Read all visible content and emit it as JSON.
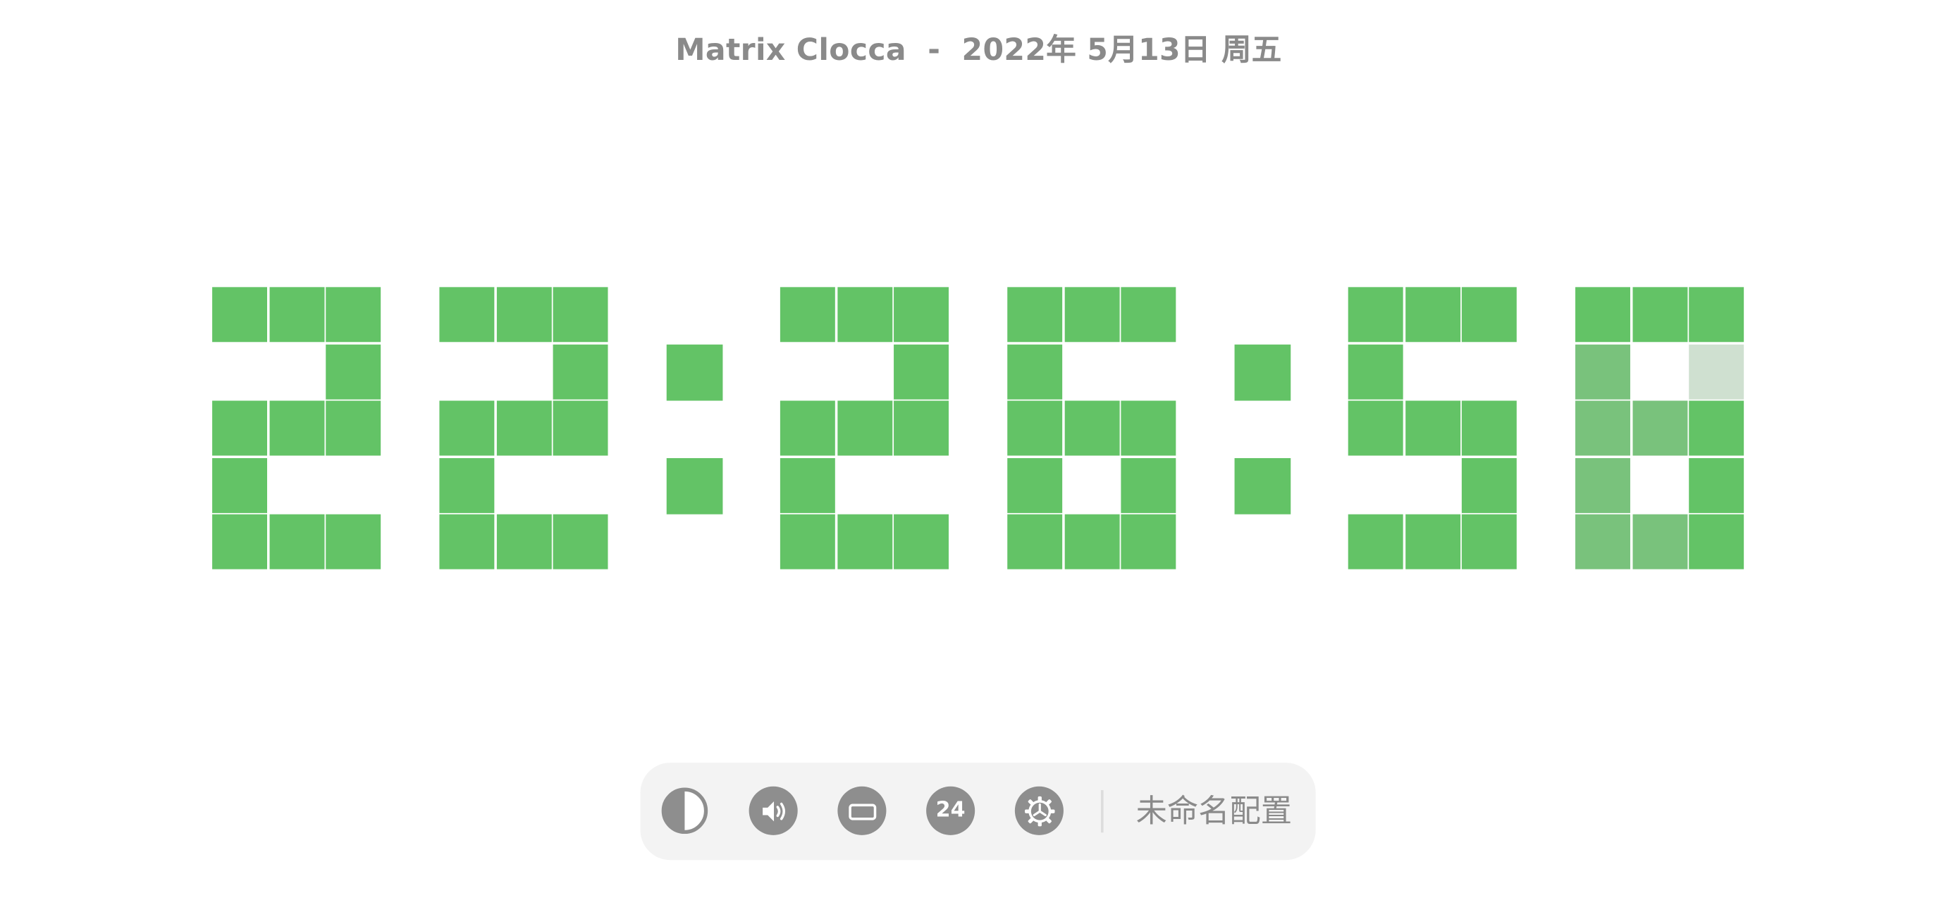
{
  "title": "Matrix Clocca  -  2022年 5月13日 周五",
  "clock": {
    "time": "22:26:58",
    "digits": [
      {
        "value": "2",
        "cells": [
          [
            "on",
            "on",
            "on"
          ],
          [
            "off",
            "off",
            "on"
          ],
          [
            "on",
            "on",
            "on"
          ],
          [
            "on",
            "off",
            "off"
          ],
          [
            "on",
            "on",
            "on"
          ]
        ]
      },
      {
        "value": "2",
        "cells": [
          [
            "on",
            "on",
            "on"
          ],
          [
            "off",
            "off",
            "on"
          ],
          [
            "on",
            "on",
            "on"
          ],
          [
            "on",
            "off",
            "off"
          ],
          [
            "on",
            "on",
            "on"
          ]
        ]
      },
      {
        "value": "2",
        "cells": [
          [
            "on",
            "on",
            "on"
          ],
          [
            "off",
            "off",
            "on"
          ],
          [
            "on",
            "on",
            "on"
          ],
          [
            "on",
            "off",
            "off"
          ],
          [
            "on",
            "on",
            "on"
          ]
        ]
      },
      {
        "value": "6",
        "cells": [
          [
            "on",
            "on",
            "on"
          ],
          [
            "on",
            "off",
            "off"
          ],
          [
            "on",
            "on",
            "on"
          ],
          [
            "on",
            "off",
            "on"
          ],
          [
            "on",
            "on",
            "on"
          ]
        ]
      },
      {
        "value": "5",
        "cells": [
          [
            "on",
            "on",
            "on"
          ],
          [
            "on",
            "off",
            "off"
          ],
          [
            "on",
            "on",
            "on"
          ],
          [
            "off",
            "off",
            "on"
          ],
          [
            "on",
            "on",
            "on"
          ]
        ]
      },
      {
        "value": "8",
        "cells": [
          [
            "on",
            "on",
            "on"
          ],
          [
            "fade",
            "off",
            "fade-light"
          ],
          [
            "fade",
            "fade",
            "on"
          ],
          [
            "fade",
            "off",
            "on"
          ],
          [
            "fade",
            "fade",
            "on"
          ]
        ]
      }
    ],
    "colors": {
      "on": "#63c366",
      "fade": "#79c27c",
      "fade-light": "#cfe0d0",
      "off": "transparent"
    }
  },
  "toolbar": {
    "buttons": [
      {
        "name": "theme-toggle-button",
        "icon": "contrast-icon"
      },
      {
        "name": "sound-toggle-button",
        "icon": "speaker-icon"
      },
      {
        "name": "fullscreen-toggle-button",
        "icon": "display-icon"
      },
      {
        "name": "hour-format-button",
        "icon": "24h-icon",
        "label": "24"
      },
      {
        "name": "settings-button",
        "icon": "gear-icon"
      }
    ],
    "config_label": "未命名配置"
  }
}
